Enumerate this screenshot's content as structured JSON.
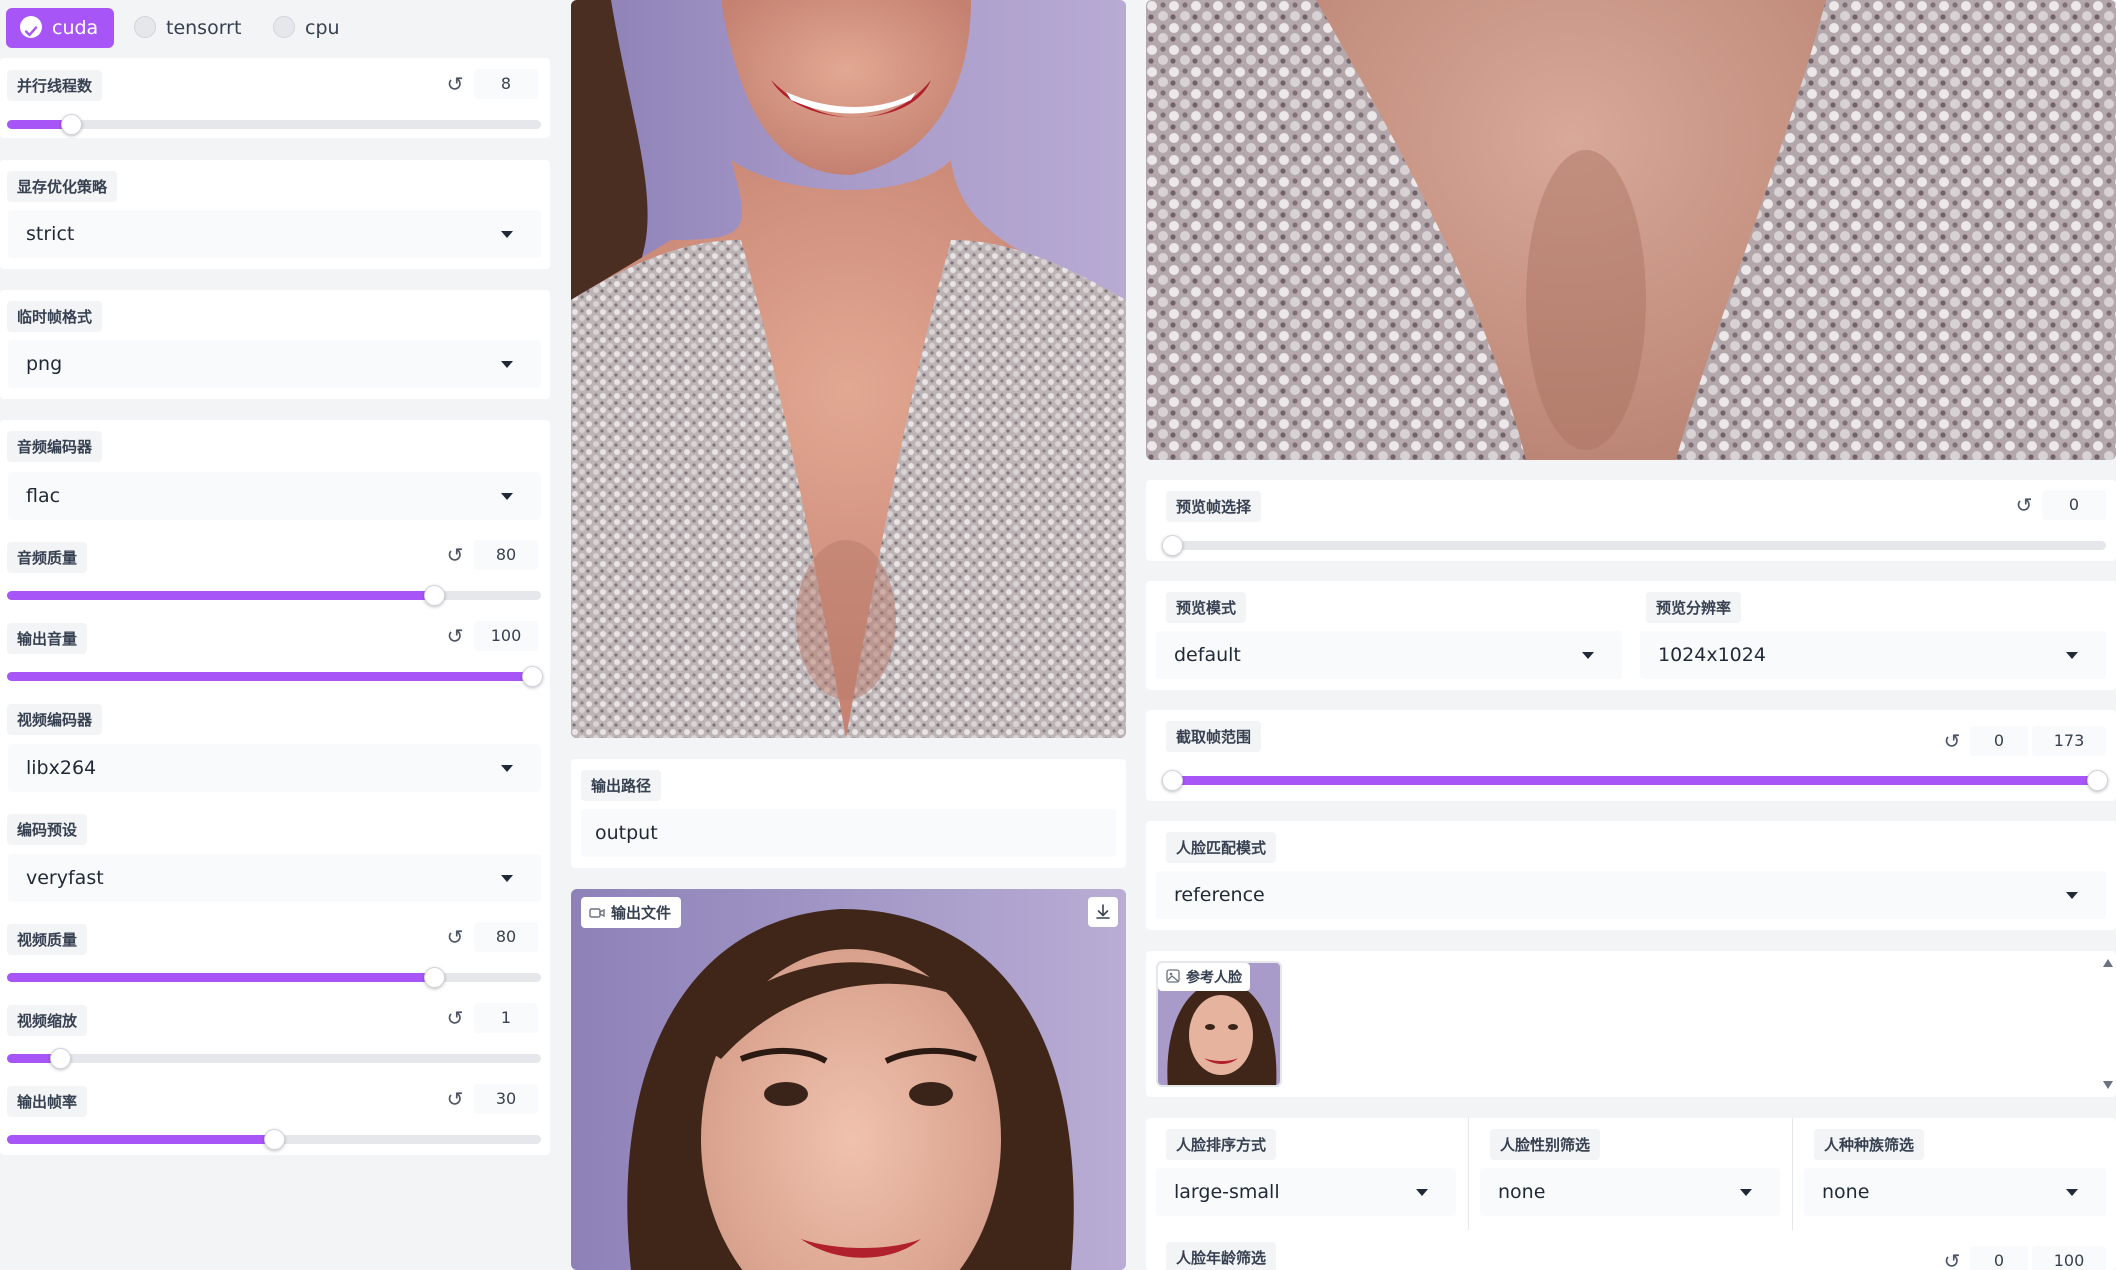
{
  "providers": [
    {
      "label": "cuda",
      "selected": true
    },
    {
      "label": "tensorrt",
      "selected": false
    },
    {
      "label": "cpu",
      "selected": false
    }
  ],
  "left": {
    "threads": {
      "label": "并行线程数",
      "value": "8",
      "level": 0.12
    },
    "memory_strategy": {
      "label": "显存优化策略",
      "value": "strict"
    },
    "temp_frame_format": {
      "label": "临时帧格式",
      "value": "png"
    },
    "audio_encoder": {
      "label": "音频编码器",
      "value": "flac"
    },
    "audio_quality": {
      "label": "音频质量",
      "value": "80",
      "level": 0.8
    },
    "output_volume": {
      "label": "输出音量",
      "value": "100",
      "level": 1.0
    },
    "video_encoder": {
      "label": "视频编码器",
      "value": "libx264"
    },
    "encoder_preset": {
      "label": "编码预设",
      "value": "veryfast"
    },
    "video_quality": {
      "label": "视频质量",
      "value": "80",
      "level": 0.8
    },
    "video_scale": {
      "label": "视频缩放",
      "value": "1",
      "level": 0.1
    },
    "output_fps": {
      "label": "输出帧率",
      "value": "30",
      "level": 0.5
    }
  },
  "middle": {
    "output_path": {
      "label": "输出路径",
      "value": "output"
    },
    "output_file": {
      "label": "输出文件"
    }
  },
  "right": {
    "preview_frame": {
      "label": "预览帧选择",
      "value": "0",
      "level": 0.0
    },
    "preview_mode": {
      "label": "预览模式",
      "value": "default"
    },
    "preview_resolution": {
      "label": "预览分辨率",
      "value": "1024x1024"
    },
    "trim_range": {
      "label": "截取帧范围",
      "start": "0",
      "end": "173",
      "level_start": 0.0,
      "level_end": 1.0
    },
    "face_selector_mode": {
      "label": "人脸匹配模式",
      "value": "reference"
    },
    "reference_face": {
      "label": "参考人脸"
    },
    "face_order": {
      "label": "人脸排序方式",
      "value": "large-small"
    },
    "face_gender": {
      "label": "人脸性别筛选",
      "value": "none"
    },
    "face_race": {
      "label": "人种种族筛选",
      "value": "none"
    },
    "face_age": {
      "label": "人脸年龄筛选",
      "start": "0",
      "end": "100"
    }
  },
  "colors": {
    "accent": "#a855f7",
    "accent_button": "#a855f7"
  }
}
